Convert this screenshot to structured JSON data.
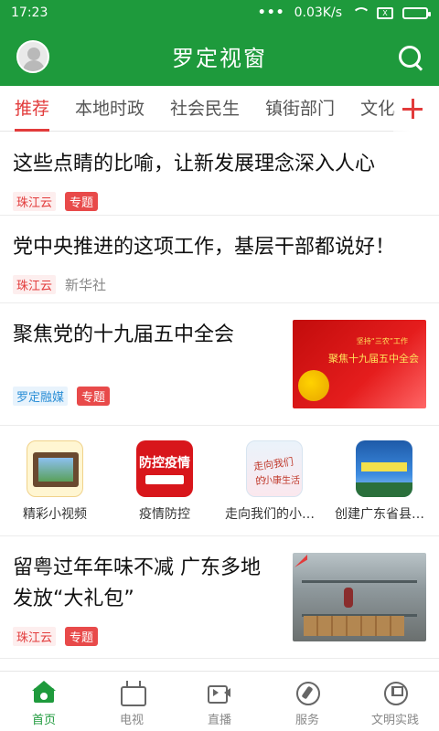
{
  "status_bar": {
    "time": "17:23",
    "network_speed": "0.03K/s",
    "sim_label": "X"
  },
  "header": {
    "title": "罗定视窗"
  },
  "tabs": [
    {
      "label": "推荐"
    },
    {
      "label": "本地时政"
    },
    {
      "label": "社会民生"
    },
    {
      "label": "镇街部门"
    },
    {
      "label": "文化"
    }
  ],
  "feed": [
    {
      "title": "这些点睛的比喻，让新发展理念深入人心",
      "source": "珠江云",
      "tag": "专题"
    },
    {
      "title": "党中央推进的这项工作，基层干部都说好！",
      "source": "珠江云",
      "publisher": "新华社"
    },
    {
      "title": "聚焦党的十九届五中全会",
      "source": "罗定融媒",
      "tag": "专题",
      "image_text_small": "坚持“三农”工作",
      "image_text": "聚焦十九届五中全会"
    },
    {
      "title_line1": "留粤过年年味不减 广东多地",
      "title_line2": "发放“大礼包”",
      "source": "珠江云",
      "tag": "专题"
    }
  ],
  "quick_links": [
    {
      "label": "精彩小视频",
      "icon": "video-film-icon"
    },
    {
      "label": "疫情防控",
      "icon": "epidemic-icon",
      "image_text": "防控疫情"
    },
    {
      "label": "走向我们的小康...",
      "icon": "xiaokang-icon",
      "image_text": "走向我们的",
      "image_text2": "小康生活"
    },
    {
      "label": "创建广东省县级...",
      "icon": "county-icon"
    }
  ],
  "bottom_nav": [
    {
      "label": "首页",
      "icon": "home-icon",
      "active": true
    },
    {
      "label": "电视",
      "icon": "tv-icon"
    },
    {
      "label": "直播",
      "icon": "live-video-icon"
    },
    {
      "label": "服务",
      "icon": "compass-icon"
    },
    {
      "label": "文明实践",
      "icon": "flag-icon"
    }
  ],
  "colors": {
    "brand_green": "#1e9a3c",
    "accent_red": "#e23b3b",
    "source_blue": "#2b8fd6"
  }
}
